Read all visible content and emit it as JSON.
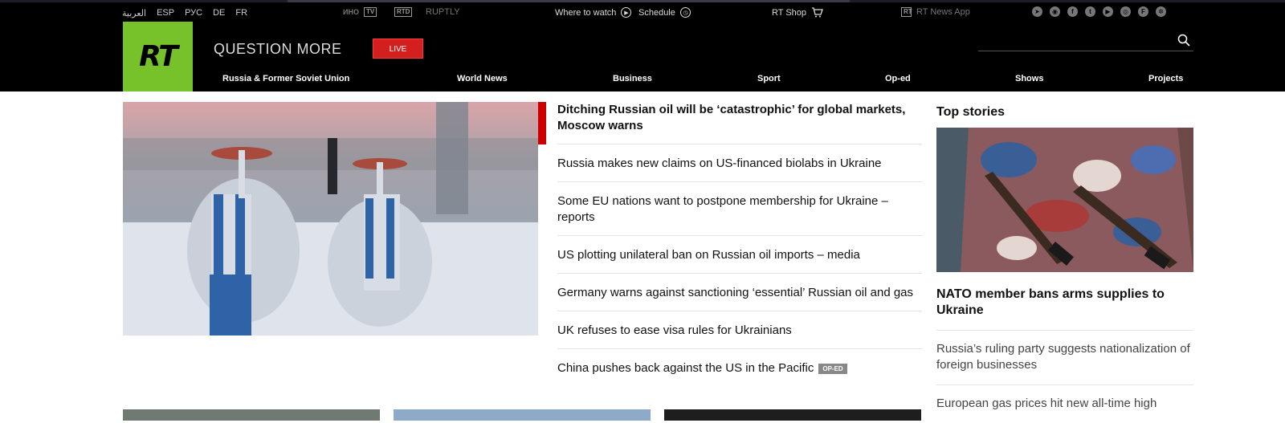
{
  "topbar": {
    "languages": [
      "العربية",
      "ESP",
      "РУС",
      "DE",
      "FR"
    ],
    "inotv": "ИНО",
    "rtd": "RTD",
    "ruptly": "RUPTLY",
    "where_to_watch": "Where to watch",
    "schedule": "Schedule",
    "rt_shop": "RT Shop",
    "news_app": "RT News App",
    "social_icons": [
      "telegram-icon",
      "rss-icon",
      "facebook-icon",
      "twitter-icon",
      "youtube-icon",
      "instagram-icon",
      "flipboard-icon",
      "rumble-icon"
    ]
  },
  "header": {
    "logo": "RT",
    "tagline": "QUESTION MORE",
    "live_label": "LIVE",
    "brand_color": "#77c12b",
    "live_color": "#d41f1f"
  },
  "nav": [
    "Russia & Former Soviet Union",
    "World News",
    "Business",
    "Sport",
    "Op-ed",
    "Shows",
    "Projects"
  ],
  "main_news": [
    "Ditching Russian oil will be ‘catastrophic’ for global markets, Moscow warns",
    "Russia makes new claims on US-financed biolabs in Ukraine",
    "Some EU nations want to postpone membership for Ukraine – reports",
    "US plotting unilateral ban on Russian oil imports – media",
    "Germany warns against sanctioning ‘essential’ Russian oil and gas",
    "UK refuses to ease visa rules for Ukrainians",
    "China pushes back against the US in the Pacific"
  ],
  "oped_badge": "OP-ED",
  "top_stories": {
    "title": "Top stories",
    "headline": "NATO member bans arms supplies to Ukraine",
    "items": [
      "Russia’s ruling party suggests nationalization of foreign businesses",
      "European gas prices hit new all-time high"
    ]
  }
}
